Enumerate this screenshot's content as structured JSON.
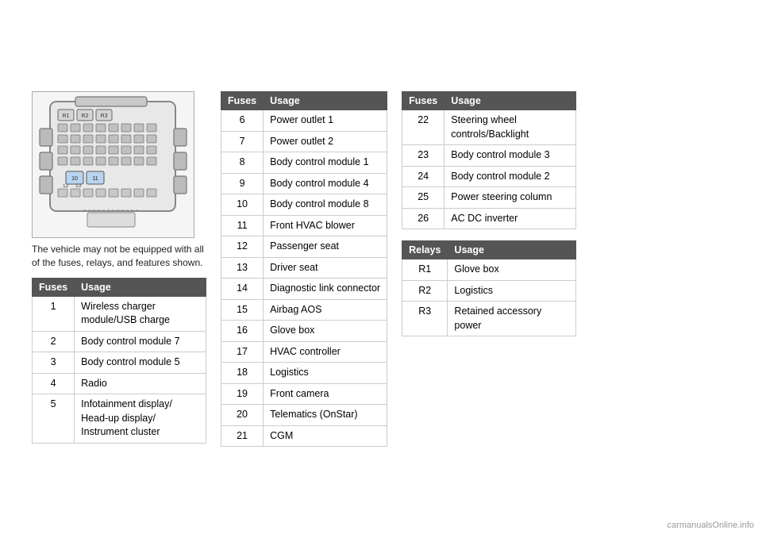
{
  "diagram_caption": "The vehicle may not be equipped with all of the fuses, relays, and features shown.",
  "left_table": {
    "col1": "Fuses",
    "col2": "Usage",
    "rows": [
      {
        "fuse": "1",
        "usage": "Wireless charger module/USB charge"
      },
      {
        "fuse": "2",
        "usage": "Body control module 7"
      },
      {
        "fuse": "3",
        "usage": "Body control module 5"
      },
      {
        "fuse": "4",
        "usage": "Radio"
      },
      {
        "fuse": "5",
        "usage": "Infotainment display/ Head-up display/ Instrument cluster"
      }
    ]
  },
  "mid_table": {
    "col1": "Fuses",
    "col2": "Usage",
    "rows": [
      {
        "fuse": "6",
        "usage": "Power outlet 1"
      },
      {
        "fuse": "7",
        "usage": "Power outlet 2"
      },
      {
        "fuse": "8",
        "usage": "Body control module 1"
      },
      {
        "fuse": "9",
        "usage": "Body control module 4"
      },
      {
        "fuse": "10",
        "usage": "Body control module 8"
      },
      {
        "fuse": "11",
        "usage": "Front HVAC blower"
      },
      {
        "fuse": "12",
        "usage": "Passenger seat"
      },
      {
        "fuse": "13",
        "usage": "Driver seat"
      },
      {
        "fuse": "14",
        "usage": "Diagnostic link connector"
      },
      {
        "fuse": "15",
        "usage": "Airbag AOS"
      },
      {
        "fuse": "16",
        "usage": "Glove box"
      },
      {
        "fuse": "17",
        "usage": "HVAC controller"
      },
      {
        "fuse": "18",
        "usage": "Logistics"
      },
      {
        "fuse": "19",
        "usage": "Front camera"
      },
      {
        "fuse": "20",
        "usage": "Telematics (OnStar)"
      },
      {
        "fuse": "21",
        "usage": "CGM"
      }
    ]
  },
  "right_top_table": {
    "col1": "Fuses",
    "col2": "Usage",
    "rows": [
      {
        "fuse": "22",
        "usage": "Steering wheel controls/Backlight"
      },
      {
        "fuse": "23",
        "usage": "Body control module 3"
      },
      {
        "fuse": "24",
        "usage": "Body control module 2"
      },
      {
        "fuse": "25",
        "usage": "Power steering column"
      },
      {
        "fuse": "26",
        "usage": "AC DC inverter"
      }
    ]
  },
  "right_bottom_table": {
    "col1": "Relays",
    "col2": "Usage",
    "rows": [
      {
        "fuse": "R1",
        "usage": "Glove box"
      },
      {
        "fuse": "R2",
        "usage": "Logistics"
      },
      {
        "fuse": "R3",
        "usage": "Retained accessory power"
      }
    ]
  },
  "watermark": "carmanualsOnline.info"
}
